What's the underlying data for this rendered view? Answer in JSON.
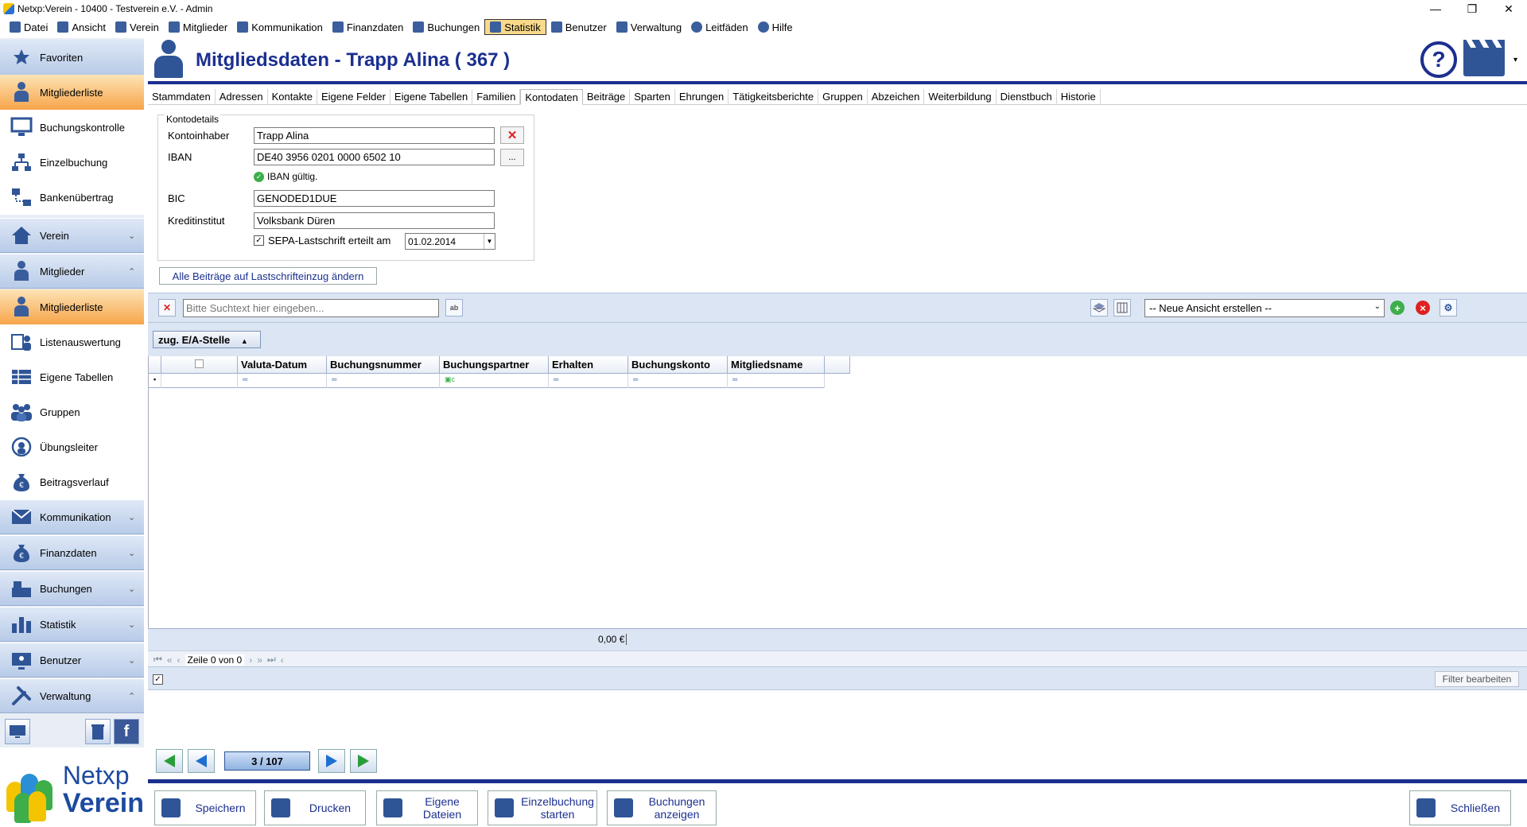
{
  "window": {
    "title": "Netxp:Verein - 10400 - Testverein e.V. - Admin",
    "controls": [
      "—",
      "❐",
      "✕"
    ]
  },
  "menu": [
    {
      "label": "Datei",
      "icon": "disk-icon"
    },
    {
      "label": "Ansicht",
      "icon": "phone-icon"
    },
    {
      "label": "Verein",
      "icon": "house-icon"
    },
    {
      "label": "Mitglieder",
      "icon": "person-icon"
    },
    {
      "label": "Kommunikation",
      "icon": "envelope-icon"
    },
    {
      "label": "Finanzdaten",
      "icon": "money-bag-icon"
    },
    {
      "label": "Buchungen",
      "icon": "register-icon"
    },
    {
      "label": "Statistik",
      "icon": "bar-chart-icon",
      "active": true
    },
    {
      "label": "Benutzer",
      "icon": "monitor-icon"
    },
    {
      "label": "Verwaltung",
      "icon": "tools-icon"
    },
    {
      "label": "Leitfäden",
      "icon": "info-icon"
    },
    {
      "label": "Hilfe",
      "icon": "help-icon"
    }
  ],
  "sidebar": {
    "favoriten": "Favoriten",
    "fav_items": [
      "Mitgliederliste",
      "Buchungskontrolle",
      "Einzelbuchung",
      "Bankenübertrag"
    ],
    "groups": {
      "verein": "Verein",
      "mitglieder": "Mitglieder",
      "kommunikation": "Kommunikation",
      "finanzdaten": "Finanzdaten",
      "buchungen": "Buchungen",
      "statistik": "Statistik",
      "benutzer": "Benutzer",
      "verwaltung": "Verwaltung"
    },
    "mitglieder_items": [
      "Mitgliederliste",
      "Listenauswertung",
      "Eigene Tabellen",
      "Gruppen",
      "Übungsleiter",
      "Beitragsverlauf"
    ],
    "logo_line1": "Netxp",
    "logo_line2": "Verein"
  },
  "header": {
    "title": "Mitgliedsdaten - Trapp Alina ( 367 )",
    "help_glyph": "?"
  },
  "tabs": [
    "Stammdaten",
    "Adressen",
    "Kontakte",
    "Eigene Felder",
    "Eigene Tabellen",
    "Familien",
    "Kontodaten",
    "Beiträge",
    "Sparten",
    "Ehrungen",
    "Tätigkeitsberichte",
    "Gruppen",
    "Abzeichen",
    "Weiterbildung",
    "Dienstbuch",
    "Historie"
  ],
  "active_tab": "Kontodaten",
  "konto": {
    "legend": "Kontodetails",
    "kontoinhaber_label": "Kontoinhaber",
    "kontoinhaber_value": "Trapp Alina",
    "iban_label": "IBAN",
    "iban_value": "DE40 3956 0201 0000 6502 10",
    "iban_btn": "...",
    "iban_valid": "IBAN gültig.",
    "bic_label": "BIC",
    "bic_value": "GENODED1DUE",
    "kredit_label": "Kreditinstitut",
    "kredit_value": "Volksbank Düren",
    "sepa_label": "SEPA-Lastschrift erteilt am",
    "sepa_checked": true,
    "sepa_date": "01.02.2014"
  },
  "alle_button": "Alle Beiträge auf Lastschrifteinzug ändern",
  "search": {
    "placeholder": "Bitte Suchtext hier eingeben...",
    "view_select": "-- Neue Ansicht erstellen --"
  },
  "grid": {
    "group_chip": "zug. E/A-Stelle",
    "columns": [
      "Valuta-Datum",
      "Buchungsnummer",
      "Buchungspartner",
      "Erhalten",
      "Buchungskonto",
      "Mitgliedsname"
    ],
    "sum": "0,00 €",
    "row_info": "Zeile 0 von 0",
    "filter_button": "Filter bearbeiten"
  },
  "pager": {
    "position": "3 / 107"
  },
  "bottom": {
    "speichern": "Speichern",
    "drucken": "Drucken",
    "eigene_dateien": "Eigene Dateien",
    "einzelbuchung": "Einzelbuchung starten",
    "buchungen_anzeigen": "Buchungen anzeigen",
    "schliessen": "Schließen"
  },
  "colors": {
    "brand_blue": "#1b2f8f",
    "sidebar_orange": "#f7a54a",
    "toolbar_bg": "#dbe5f3"
  }
}
